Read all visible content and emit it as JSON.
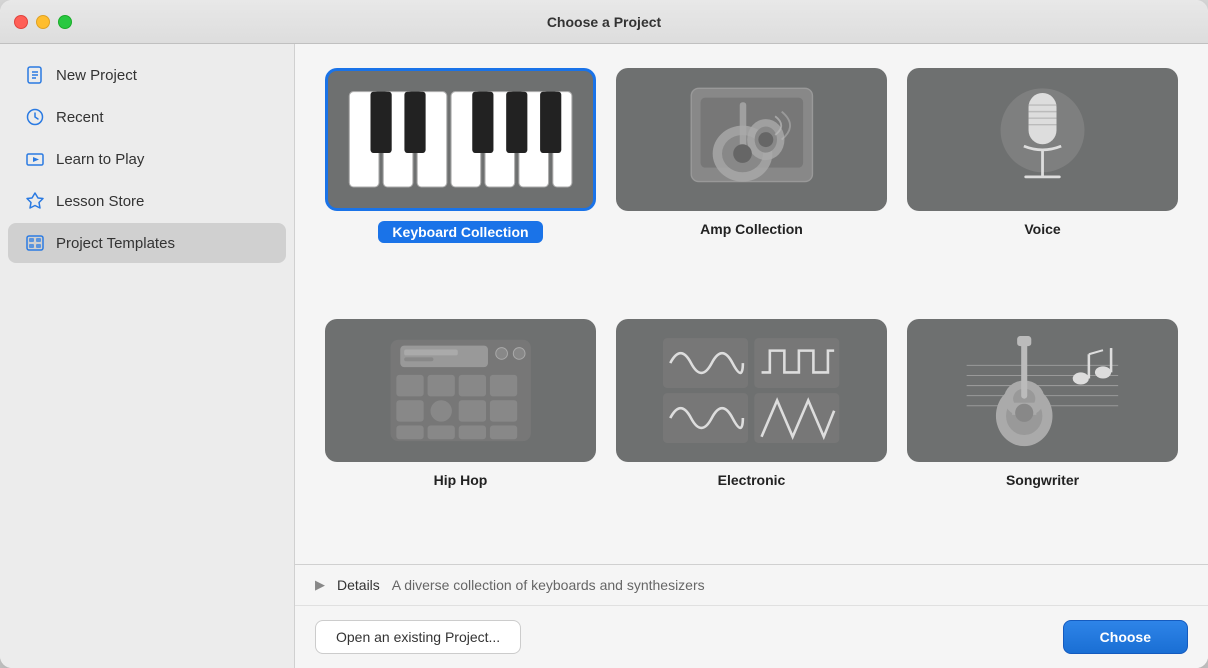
{
  "window": {
    "title": "Choose a Project"
  },
  "titlebar": {
    "title": "Choose a Project"
  },
  "sidebar": {
    "items": [
      {
        "id": "new-project",
        "label": "New Project",
        "icon": "new-project-icon"
      },
      {
        "id": "recent",
        "label": "Recent",
        "icon": "recent-icon"
      },
      {
        "id": "learn-to-play",
        "label": "Learn to Play",
        "icon": "learn-to-play-icon"
      },
      {
        "id": "lesson-store",
        "label": "Lesson Store",
        "icon": "lesson-store-icon"
      },
      {
        "id": "project-templates",
        "label": "Project Templates",
        "icon": "project-templates-icon",
        "active": true
      }
    ]
  },
  "templates": {
    "items": [
      {
        "id": "keyboard-collection",
        "label": "Keyboard Collection",
        "selected": true
      },
      {
        "id": "amp-collection",
        "label": "Amp Collection",
        "selected": false
      },
      {
        "id": "voice",
        "label": "Voice",
        "selected": false
      },
      {
        "id": "hip-hop",
        "label": "Hip Hop",
        "selected": false
      },
      {
        "id": "electronic",
        "label": "Electronic",
        "selected": false
      },
      {
        "id": "songwriter",
        "label": "Songwriter",
        "selected": false
      }
    ]
  },
  "details": {
    "label": "Details",
    "description": "A diverse collection of keyboards and synthesizers"
  },
  "actions": {
    "open_existing": "Open an existing Project...",
    "choose": "Choose"
  }
}
